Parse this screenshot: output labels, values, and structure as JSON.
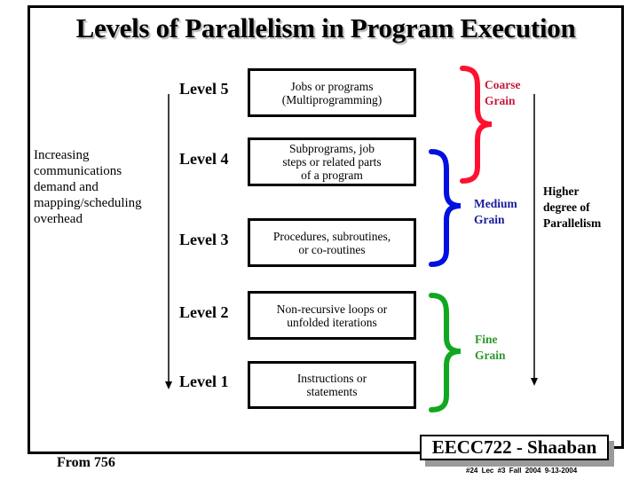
{
  "title": "Levels of Parallelism in Program Execution",
  "left_note": {
    "lines": [
      "Increasing",
      "communications",
      "demand and",
      "mapping/scheduling",
      "overhead"
    ],
    "arrow_direction": "down"
  },
  "levels": [
    {
      "label": "Level 5",
      "description_lines": [
        "Jobs or programs",
        "(Multiprogramming)"
      ]
    },
    {
      "label": "Level 4",
      "description_lines": [
        "Subprograms, job",
        "steps or related parts",
        "of a program"
      ]
    },
    {
      "label": "Level 3",
      "description_lines": [
        "Procedures, subroutines,",
        "or co-routines"
      ]
    },
    {
      "label": "Level 2",
      "description_lines": [
        "Non-recursive loops or",
        "unfolded iterations"
      ]
    },
    {
      "label": "Level 1",
      "description_lines": [
        "Instructions or",
        "statements"
      ]
    }
  ],
  "grains": [
    {
      "name": "coarse",
      "lines": [
        "Coarse",
        "Grain"
      ],
      "covers": [
        "Level 5",
        "Level 4"
      ],
      "brace_color": "#ff1030",
      "text_color": "#c41c3c"
    },
    {
      "name": "medium",
      "lines": [
        "Medium",
        "Grain"
      ],
      "covers": [
        "Level 4",
        "Level 3"
      ],
      "brace_color": "#0010e0",
      "text_color": "#1a1a9c"
    },
    {
      "name": "fine",
      "lines": [
        "Fine",
        "Grain"
      ],
      "covers": [
        "Level 2",
        "Level 1"
      ],
      "brace_color": "#10a820",
      "text_color": "#2a9a2a"
    }
  ],
  "right_note": {
    "lines": [
      "Higher",
      "degree of",
      "Parallelism"
    ],
    "arrow_direction": "down"
  },
  "footer": {
    "source": "From 756",
    "badge": "EECC722 - Shaaban",
    "meta": "#24  Lec #3  Fall 2004  9-13-2004"
  }
}
